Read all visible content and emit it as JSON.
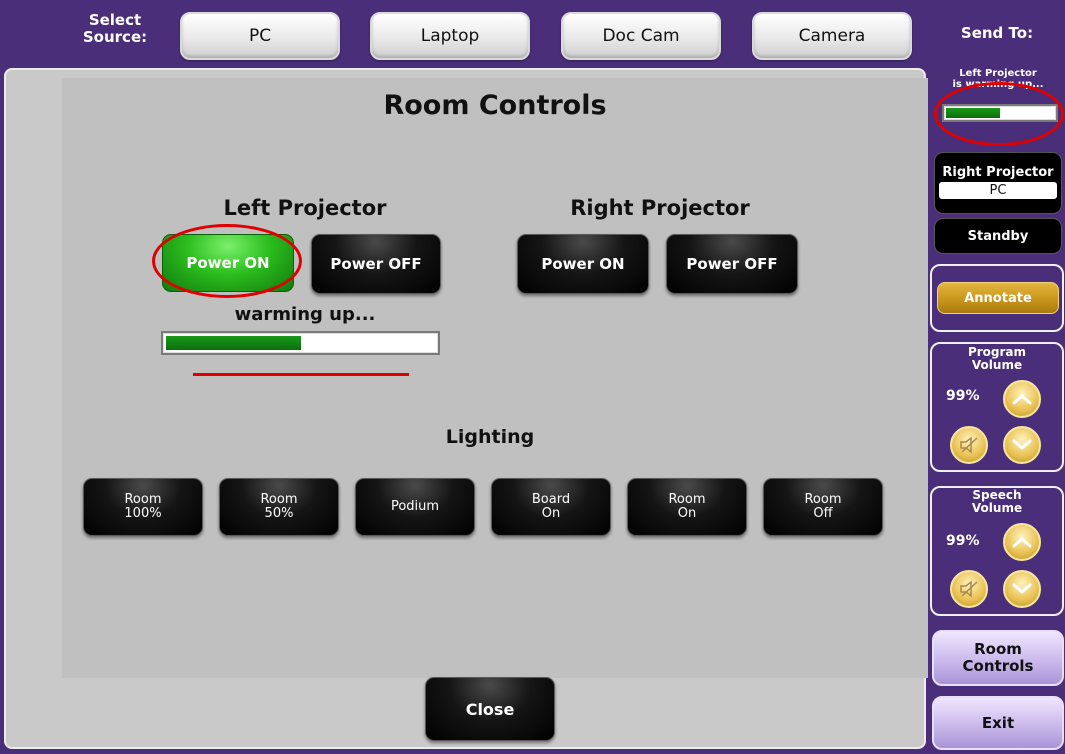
{
  "source_bar": {
    "label": "Select\nSource:",
    "sources": [
      "PC",
      "Laptop",
      "Doc Cam",
      "Camera"
    ]
  },
  "main": {
    "title": "Room Controls",
    "left_projector": {
      "title": "Left Projector",
      "power_on": "Power ON",
      "power_off": "Power OFF",
      "status": "warming up...",
      "progress": 0.5
    },
    "right_projector": {
      "title": "Right Projector",
      "power_on": "Power ON",
      "power_off": "Power OFF"
    },
    "lighting": {
      "title": "Lighting",
      "buttons": [
        "Room\n100%",
        "Room\n50%",
        "Podium",
        "Board\nOn",
        "Room\nOn",
        "Room\nOff"
      ]
    },
    "close": "Close"
  },
  "sidebar": {
    "send_to": "Send To:",
    "left_projector_status": "Left Projector\nis warming up...",
    "left_projector_progress": 0.5,
    "right_projector_label": "Right Projector",
    "right_projector_source": "PC",
    "standby": "Standby",
    "annotate": "Annotate",
    "program_volume": {
      "label": "Program\nVolume",
      "value": "99%"
    },
    "speech_volume": {
      "label": "Speech\nVolume",
      "value": "99%"
    },
    "room_controls": "Room\nControls",
    "exit": "Exit"
  },
  "colors": {
    "frame_purple": "#4a2e7a",
    "power_on_green": "#2cbd1e",
    "annotation_red": "#e00000",
    "annotate_gold": "#c9961a"
  }
}
